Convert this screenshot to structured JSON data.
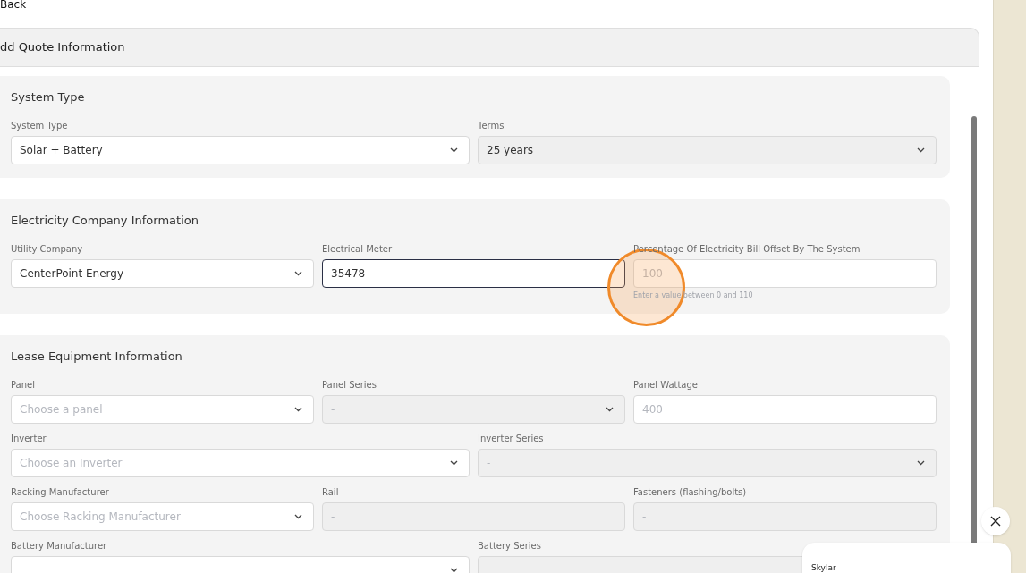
{
  "back_link": "Back",
  "page_title": "dd Quote Information",
  "sections": [
    {
      "title": "System Type",
      "rows": [
        [
          {
            "label": "System Type",
            "kind": "select",
            "value": "Solar + Battery",
            "disabled": false,
            "focused": false
          },
          {
            "label": "Terms",
            "kind": "select",
            "value": "25 years",
            "disabled": true,
            "focused": false
          }
        ]
      ]
    },
    {
      "title": "Electricity Company Information",
      "rows": [
        [
          {
            "label": "Utility Company",
            "kind": "select",
            "value": "CenterPoint Energy",
            "disabled": false,
            "focused": false
          },
          {
            "label": "Electrical Meter",
            "kind": "input",
            "value": "35478",
            "disabled": false,
            "focused": true
          },
          {
            "label": "Percentage Of Electricity Bill Offset By The System",
            "kind": "input",
            "placeholder": "100",
            "hint": "Enter a value between 0 and 110",
            "disabled": false,
            "focused": false
          }
        ]
      ]
    },
    {
      "title": "Lease Equipment Information",
      "rows": [
        [
          {
            "label": "Panel",
            "kind": "select",
            "placeholder": "Choose a panel",
            "disabled": false,
            "focused": false
          },
          {
            "label": "Panel Series",
            "kind": "select",
            "placeholder": "-",
            "disabled": true,
            "focused": false
          },
          {
            "label": "Panel Wattage",
            "kind": "input",
            "placeholder": "400",
            "disabled": false,
            "focused": false
          }
        ],
        [
          {
            "label": "Inverter",
            "kind": "select",
            "placeholder": "Choose an Inverter",
            "disabled": false,
            "focused": false
          },
          {
            "label": "Inverter Series",
            "kind": "select",
            "placeholder": "-",
            "disabled": true,
            "focused": false
          }
        ],
        [
          {
            "label": "Racking Manufacturer",
            "kind": "select",
            "placeholder": "Choose Racking Manufacturer",
            "disabled": false,
            "focused": false
          },
          {
            "label": "Rail",
            "kind": "input",
            "placeholder": "-",
            "disabled": true,
            "focused": false
          },
          {
            "label": "Fasteners (flashing/bolts)",
            "kind": "input",
            "placeholder": "-",
            "disabled": true,
            "focused": false
          }
        ],
        [
          {
            "label": "Battery Manufacturer",
            "kind": "select",
            "disabled": false,
            "focused": false
          },
          {
            "label": "Battery Series",
            "kind": "select",
            "disabled": true,
            "focused": false
          }
        ]
      ]
    }
  ],
  "chat": {
    "agent_name": "Skylar"
  }
}
